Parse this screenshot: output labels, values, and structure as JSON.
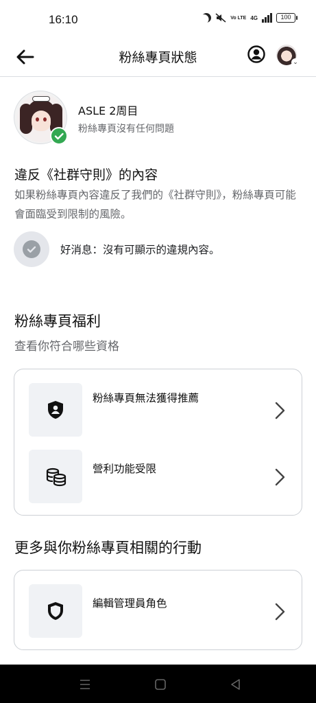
{
  "status_bar": {
    "time": "16:10",
    "network": "4G",
    "volte": "Vo LTE",
    "battery": "100"
  },
  "header": {
    "title": "粉絲專頁狀態"
  },
  "page": {
    "name": "ASLE 2周目",
    "status": "粉絲專頁沒有任何問題"
  },
  "violations": {
    "title": "違反《社群守則》的內容",
    "description": "如果粉絲專頁內容違反了我們的《社群守則》，粉絲專頁可能會面臨受到限制的風險。",
    "good_news": "好消息：沒有可顯示的違規內容。"
  },
  "benefits": {
    "title": "粉絲專頁福利",
    "subtitle": "查看你符合哪些資格",
    "items": [
      {
        "label": "粉絲專頁無法獲得推薦",
        "icon": "shield-person-icon"
      },
      {
        "label": "營利功能受限",
        "icon": "coins-icon"
      }
    ]
  },
  "actions": {
    "title": "更多與你粉絲專頁相關的行動",
    "items": [
      {
        "label": "編輯管理員角色",
        "icon": "shield-icon"
      }
    ]
  },
  "colors": {
    "verified_green": "#33a852",
    "secondary_text": "#65676b",
    "icon_bg": "#f0f2f5"
  }
}
